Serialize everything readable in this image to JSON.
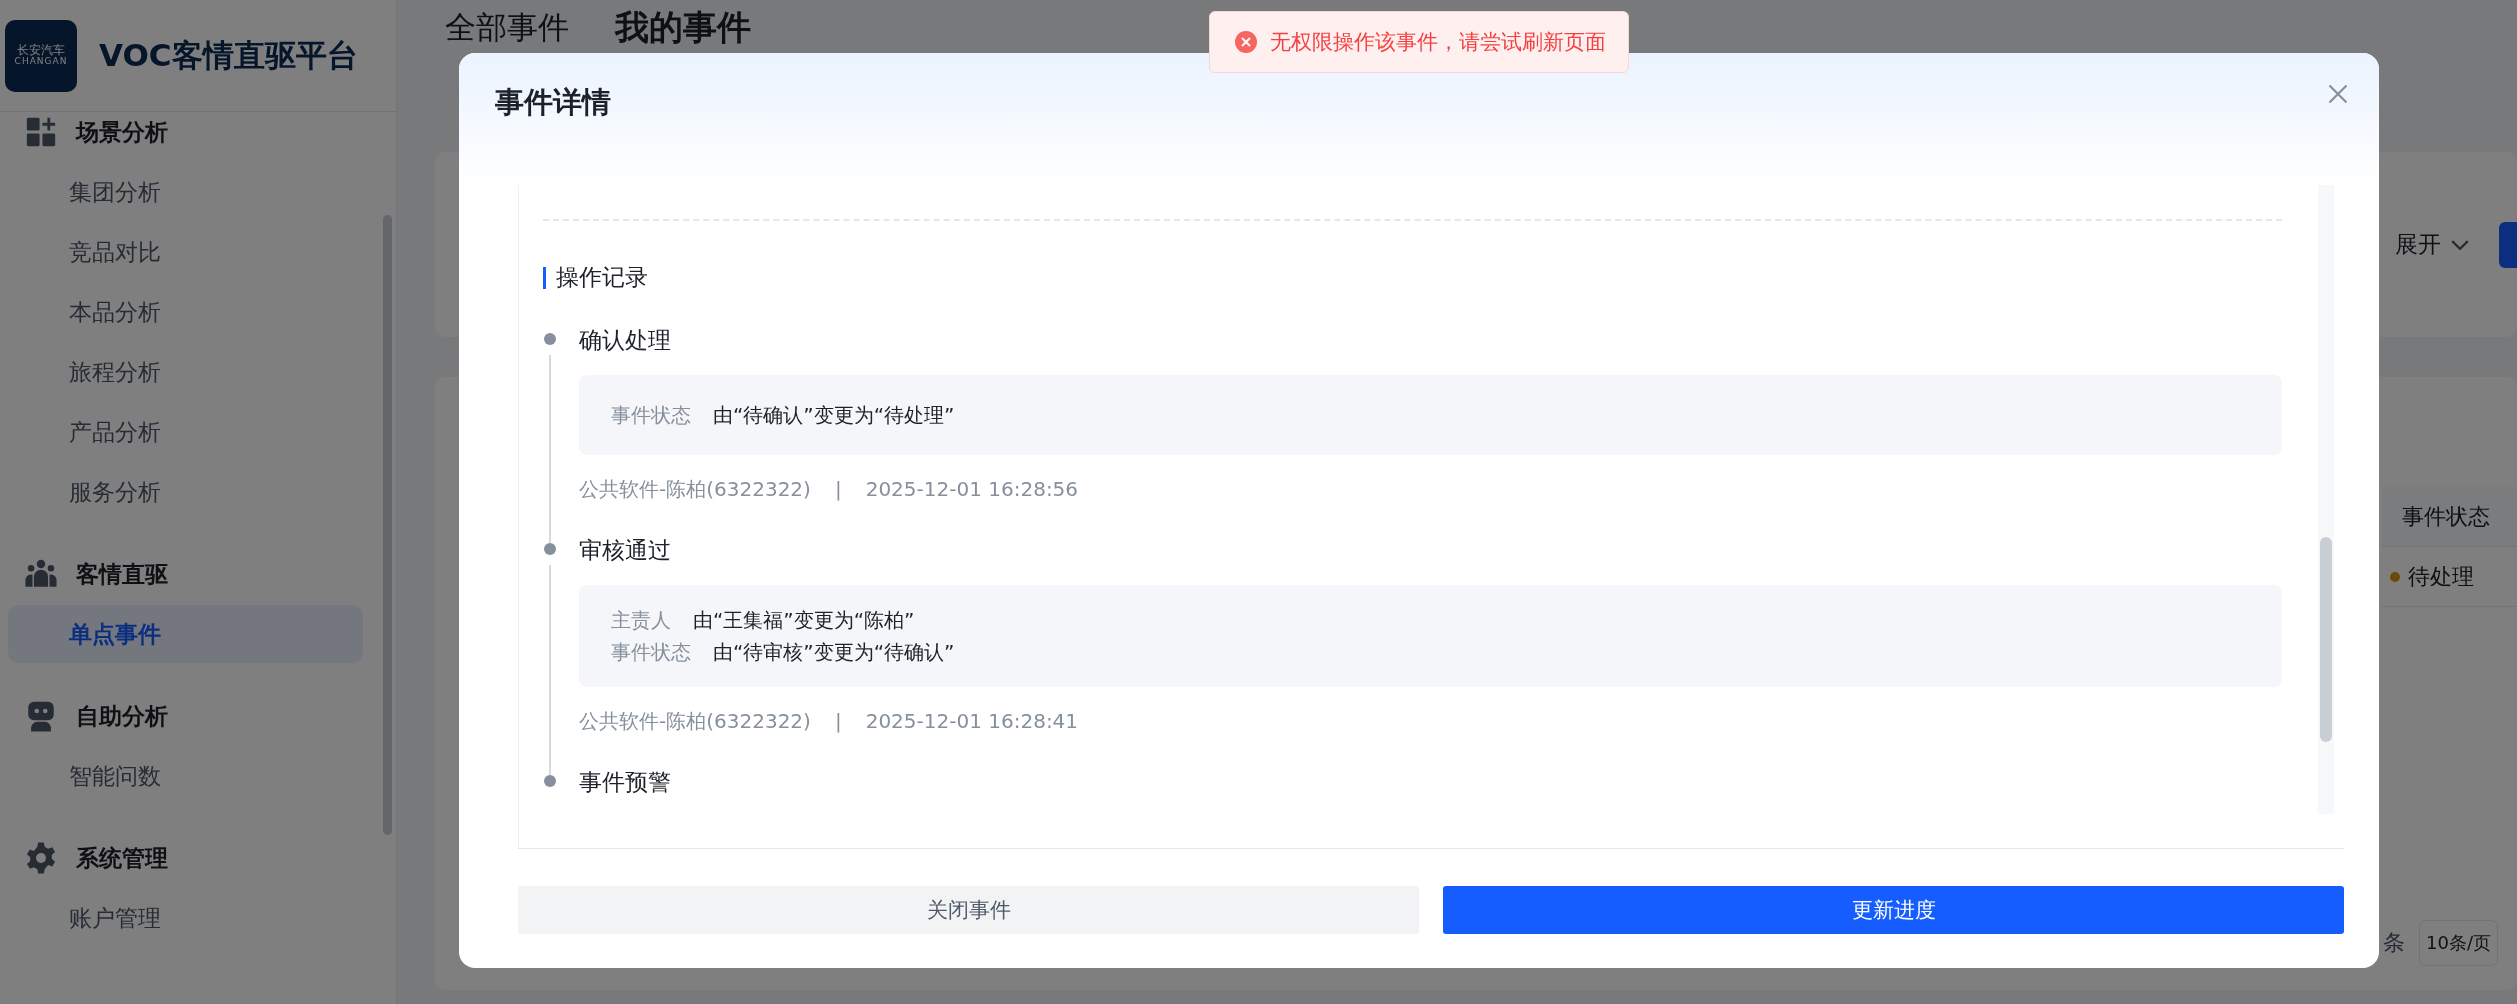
{
  "sidebar": {
    "logo": {
      "line1": "长安汽车",
      "line2": "CHANGAN"
    },
    "title": "VOC客情直驱平台",
    "groups": [
      {
        "label": "场景分析",
        "items": [
          {
            "label": "集团分析",
            "selected": false
          },
          {
            "label": "竞品对比",
            "selected": false
          },
          {
            "label": "本品分析",
            "selected": false
          },
          {
            "label": "旅程分析",
            "selected": false
          },
          {
            "label": "产品分析",
            "selected": false
          },
          {
            "label": "服务分析",
            "selected": false
          }
        ]
      },
      {
        "label": "客情直驱",
        "items": [
          {
            "label": "单点事件",
            "selected": true
          }
        ]
      },
      {
        "label": "自助分析",
        "items": [
          {
            "label": "智能问数",
            "selected": false
          }
        ]
      },
      {
        "label": "系统管理",
        "items": [
          {
            "label": "账户管理",
            "selected": false
          }
        ]
      }
    ]
  },
  "main": {
    "tabs": [
      {
        "label": "全部事件",
        "selected": false
      },
      {
        "label": "我的事件",
        "selected": true
      }
    ],
    "expand_button": "展开",
    "table": {
      "column": "事件状态",
      "rows": [
        {
          "status": "待处理"
        }
      ]
    },
    "pagination": {
      "suffix": "条",
      "page_size": "10条/页"
    }
  },
  "modal": {
    "title": "事件详情",
    "section_title": "操作记录",
    "records": [
      {
        "title": "确认处理",
        "changes": [
          {
            "field": "事件状态",
            "value": "由“待确认”变更为“待处理”"
          }
        ],
        "operator": "公共软件-陈柏(6322322)",
        "separator": "|",
        "time": "2025-12-01 16:28:56"
      },
      {
        "title": "审核通过",
        "changes": [
          {
            "field": "主责人",
            "value": "由“王集福”变更为“陈柏”"
          },
          {
            "field": "事件状态",
            "value": "由“待审核”变更为“待确认”"
          }
        ],
        "operator": "公共软件-陈柏(6322322)",
        "separator": "|",
        "time": "2025-12-01 16:28:41"
      },
      {
        "title": "事件预警"
      }
    ],
    "buttons": [
      {
        "label": "关闭事件",
        "kind": "secondary"
      },
      {
        "label": "更新进度",
        "kind": "primary"
      }
    ]
  },
  "toast": {
    "message": "无权限操作该事件，请尝试刷新页面"
  }
}
